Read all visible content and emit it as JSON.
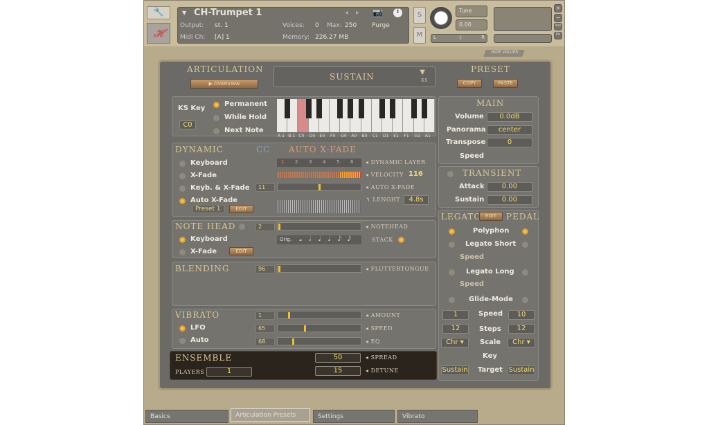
{
  "header": {
    "instrument_name": "CH-Trumpet 1",
    "output_label": "Output:",
    "output_value": "st. 1",
    "midi_label": "Midi Ch:",
    "midi_value": "[A] 1",
    "voices_label": "Voices:",
    "voices_value": "0",
    "max_label": "Max:",
    "max_value": "250",
    "memory_label": "Memory:",
    "memory_value": "226.27 MB",
    "purge_label": "Purge",
    "solo": "S",
    "mute": "M",
    "tune_label": "Tune",
    "tune_value": "0.00",
    "pan_left": "L",
    "pan_right": "R",
    "close": "×",
    "minimize": "−",
    "aux": "AUX",
    "pv": "PV",
    "hide_values": "HIDE VALUES",
    "logo_text": "CH"
  },
  "articulation": {
    "title": "ARTICULATION",
    "overview": "OVERVIEW",
    "selected": "SUSTAIN",
    "ks": "KS"
  },
  "preset": {
    "title": "PRESET",
    "copy": "COPY",
    "paste": "PASTE"
  },
  "keyswitch": {
    "ks_key_label": "KS Key",
    "ks_key_value": "C0",
    "modes": [
      {
        "label": "Permanent",
        "on": true
      },
      {
        "label": "While Hold",
        "on": false
      },
      {
        "label": "Next Note",
        "on": false
      }
    ],
    "keys": [
      "A-1",
      "B-1",
      "C0",
      "D0",
      "E0",
      "F0",
      "G0",
      "A0",
      "B0",
      "C1",
      "D1",
      "E1",
      "F1",
      "G1",
      "A1"
    ],
    "highlight_key": "C0",
    "highlight_color": "#d88a8a"
  },
  "main": {
    "title": "MAIN",
    "volume_label": "Volume",
    "volume": "0.0dB",
    "panorama_label": "Panorama",
    "panorama": "center",
    "transpose_label": "Transpose",
    "transpose": "0",
    "speed_label": "Speed"
  },
  "transient": {
    "title": "TRANSIENT",
    "attack_label": "Attack",
    "attack": "0.00",
    "sustain_label": "Sustain",
    "sustain": "0.00"
  },
  "dynamic": {
    "title": "DYNAMIC",
    "cc": "CC",
    "mode_title": "AUTO X-FADE",
    "options": [
      {
        "label": "Keyboard",
        "on": false
      },
      {
        "label": "X-Fade",
        "on": false
      },
      {
        "label": "Keyb. & X-Fade",
        "on": false
      },
      {
        "label": "Auto X-Fade",
        "on": true
      }
    ],
    "preset": "Preset 1",
    "edit": "EDIT",
    "layers": [
      "1",
      "2",
      "3",
      "4",
      "5",
      "6"
    ],
    "active_layer": "1",
    "dynamic_layer_label": "DYNAMIC LAYER",
    "velocity_label": "VELOCITY",
    "velocity": "116",
    "auto_xfade_label": "AUTO X-FADE",
    "auto_xfade_cc": "11",
    "auto_xfade_level": 0.5,
    "length_label": "LENGHT",
    "length": "4.8s"
  },
  "notehead": {
    "title": "NOTE HEAD",
    "cc": "2",
    "label": "NOTEHEAD",
    "level": 0.0,
    "options": [
      {
        "label": "Keyboard",
        "on": true
      },
      {
        "label": "X-Fade",
        "on": false
      }
    ],
    "edit": "EDIT",
    "orig": "Orig.",
    "notes": [
      "𝅝",
      "𝅗𝅥",
      "𝅘𝅥",
      "𝅘𝅥",
      "𝅘𝅥𝅮",
      "𝅘𝅥𝅮"
    ],
    "stack_label": "STACK",
    "stack_on": true
  },
  "blending": {
    "title": "BLENDING",
    "cc": "96",
    "label": "FLUTTERTONGUE",
    "level": 0.0
  },
  "vibrato": {
    "title": "VIBRATO",
    "options": [
      {
        "label": "LFO",
        "on": true
      },
      {
        "label": "Auto",
        "on": false
      }
    ],
    "rows": [
      {
        "cc": "1",
        "label": "AMOUNT",
        "level": 0.13
      },
      {
        "cc": "65",
        "label": "SPEED",
        "level": 0.32
      },
      {
        "cc": "68",
        "label": "EQ",
        "level": 0.18
      }
    ]
  },
  "ensemble": {
    "title": "ENSEMBLE",
    "players_label": "PLAYERS",
    "players": "1",
    "spread_label": "SPREAD",
    "spread": "50",
    "detune_label": "DETUNE",
    "detune": "15"
  },
  "legato": {
    "title": "LEGATO",
    "edit": "EDIT",
    "pedal": "PEDAL",
    "polyphon": "Polyphon",
    "legato_short": "Legato Short",
    "legato_long": "Legato Long",
    "speed": "Speed",
    "glide": "Glide-Mode",
    "speed_left": "1",
    "speed_right": "10",
    "steps_label": "Steps",
    "steps_left": "12",
    "steps_right": "12",
    "scale_label": "Scale",
    "scale_left": "Chr",
    "scale_right": "Chr",
    "key_label": "Key",
    "target_label": "Target",
    "target_left": "Sustain",
    "target_right": "Sustain"
  },
  "tabs": [
    {
      "label": "Basics",
      "selected": false
    },
    {
      "label": "Articulation Presets",
      "selected": true
    },
    {
      "label": "Settings",
      "selected": false
    },
    {
      "label": "Vibrato",
      "selected": false
    }
  ]
}
